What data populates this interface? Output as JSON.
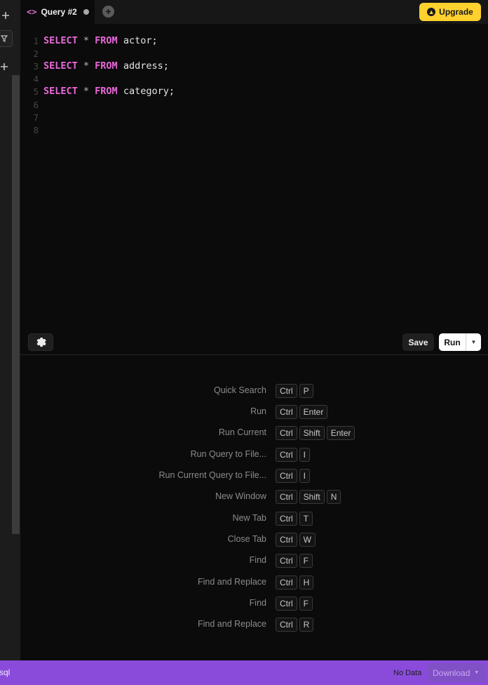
{
  "tab": {
    "code_icon": "<>",
    "title": "Query #2",
    "unsaved_dot": "modified-dot"
  },
  "header": {
    "upgrade_label": "Upgrade"
  },
  "editor": {
    "lines": [
      {
        "n": "1",
        "tokens": [
          [
            "kw",
            "SELECT"
          ],
          [
            "op",
            " * "
          ],
          [
            "kw",
            "FROM"
          ],
          [
            "id",
            " actor;"
          ]
        ]
      },
      {
        "n": "2",
        "tokens": []
      },
      {
        "n": "3",
        "tokens": [
          [
            "kw",
            "SELECT"
          ],
          [
            "op",
            " * "
          ],
          [
            "kw",
            "FROM"
          ],
          [
            "id",
            " address;"
          ]
        ]
      },
      {
        "n": "4",
        "tokens": []
      },
      {
        "n": "5",
        "tokens": [
          [
            "kw",
            "SELECT"
          ],
          [
            "op",
            " * "
          ],
          [
            "kw",
            "FROM"
          ],
          [
            "id",
            " category;"
          ]
        ]
      },
      {
        "n": "6",
        "tokens": []
      },
      {
        "n": "7",
        "tokens": []
      },
      {
        "n": "8",
        "tokens": []
      }
    ]
  },
  "toolbar": {
    "save_label": "Save",
    "run_label": "Run"
  },
  "shortcuts": [
    {
      "label": "Quick Search",
      "keys": [
        "Ctrl",
        "P"
      ]
    },
    {
      "label": "Run",
      "keys": [
        "Ctrl",
        "Enter"
      ]
    },
    {
      "label": "Run Current",
      "keys": [
        "Ctrl",
        "Shift",
        "Enter"
      ]
    },
    {
      "label": "Run Query to File...",
      "keys": [
        "Ctrl",
        "I"
      ]
    },
    {
      "label": "Run Current Query to File...",
      "keys": [
        "Ctrl",
        "I"
      ]
    },
    {
      "label": "New Window",
      "keys": [
        "Ctrl",
        "Shift",
        "N"
      ]
    },
    {
      "label": "New Tab",
      "keys": [
        "Ctrl",
        "T"
      ]
    },
    {
      "label": "Close Tab",
      "keys": [
        "Ctrl",
        "W"
      ]
    },
    {
      "label": "Find",
      "keys": [
        "Ctrl",
        "F"
      ]
    },
    {
      "label": "Find and Replace",
      "keys": [
        "Ctrl",
        "H"
      ]
    },
    {
      "label": "Find",
      "keys": [
        "Ctrl",
        "F"
      ]
    },
    {
      "label": "Find and Replace",
      "keys": [
        "Ctrl",
        "R"
      ]
    }
  ],
  "statusbar": {
    "left_text": "sql",
    "no_data": "No Data",
    "download_label": "Download"
  },
  "colors": {
    "accent_purple": "#8a4bdb",
    "upgrade_yellow": "#ffd12e",
    "keyword_pink": "#ea68d9"
  }
}
